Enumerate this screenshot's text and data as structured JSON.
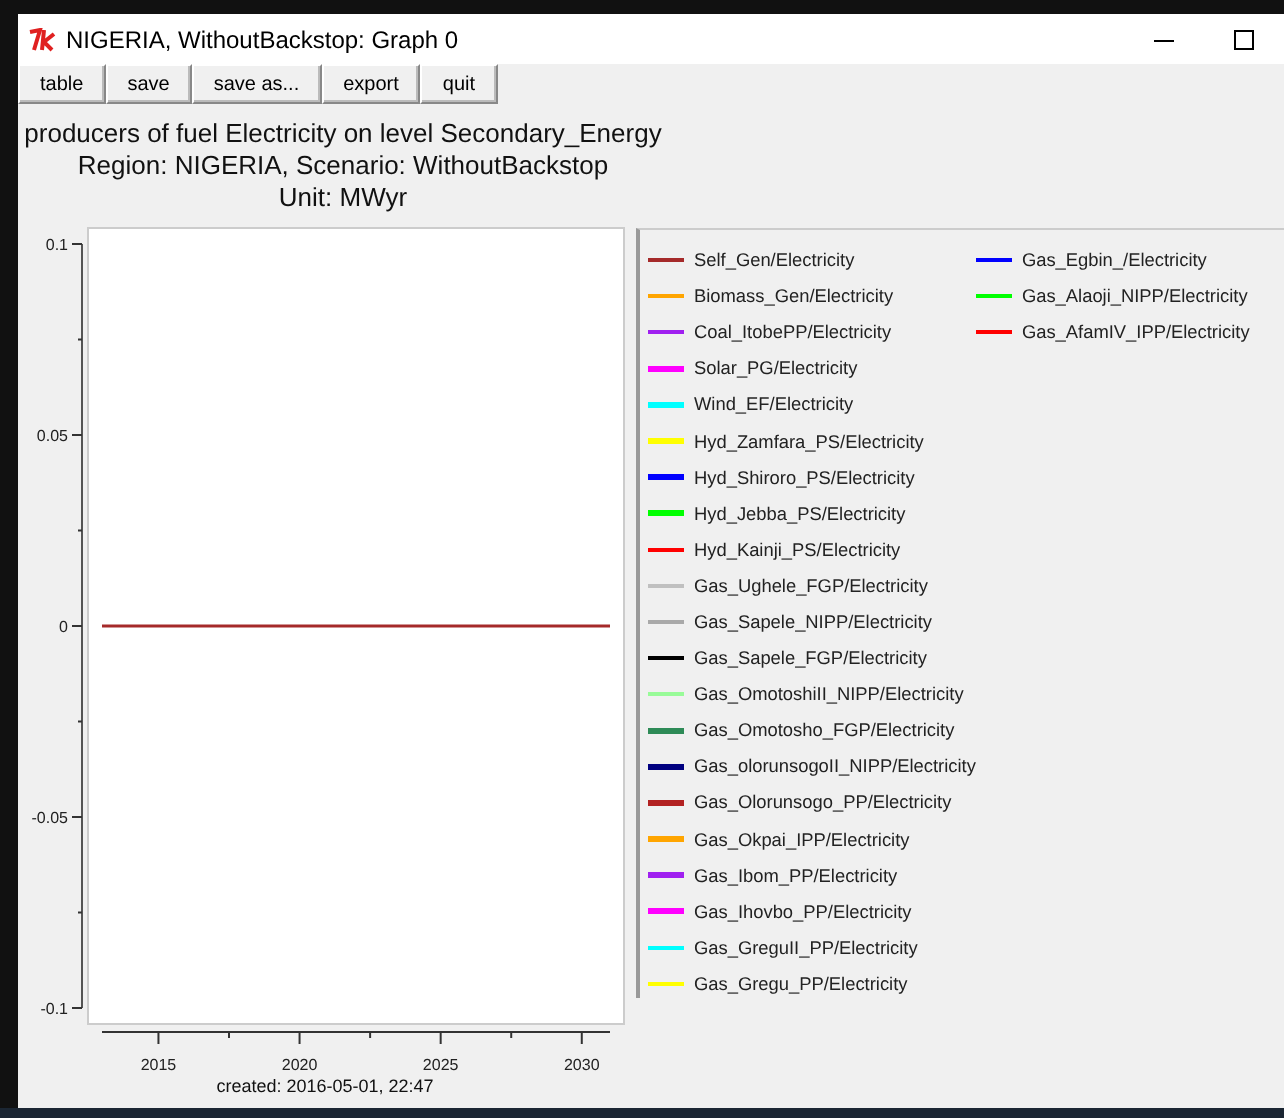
{
  "window": {
    "title": "NIGERIA, WithoutBackstop: Graph 0"
  },
  "toolbar": [
    "table",
    "save",
    "save as...",
    "export",
    "quit"
  ],
  "heading": [
    "producers of fuel Electricity on level Secondary_Energy",
    "Region: NIGERIA, Scenario: WithoutBackstop",
    "Unit: MWyr"
  ],
  "chart_data": {
    "type": "line",
    "legend": "right",
    "x": [
      2013,
      2031
    ],
    "xlim": [
      2013,
      2031
    ],
    "ylim": [
      -0.1,
      0.1
    ],
    "xticks": [
      2015,
      2020,
      2025,
      2030
    ],
    "yticks": [
      0.1,
      0.05,
      {
        "value": 0,
        "label": "0"
      },
      -0.05,
      -0.1
    ],
    "series": [
      {
        "name": "Self_Gen/Electricity",
        "color": "#a52a2a",
        "values": [
          0,
          0
        ]
      },
      {
        "name": "Biomass_Gen/Electricity",
        "color": "#ffa500",
        "values": [
          null,
          null
        ]
      },
      {
        "name": "Coal_ItobePP/Electricity",
        "color": "#a020f0",
        "values": [
          null,
          null
        ]
      },
      {
        "name": "Solar_PG/Electricity",
        "color": "#ff00ff",
        "values": [
          null,
          null
        ]
      },
      {
        "name": "Wind_EF/Electricity",
        "color": "#00ffff",
        "values": [
          null,
          null
        ]
      },
      {
        "name": "Hyd_Zamfara_PS/Electricity",
        "color": "#ffff00",
        "values": [
          null,
          null
        ]
      },
      {
        "name": "Hyd_Shiroro_PS/Electricity",
        "color": "#0000ff",
        "values": [
          null,
          null
        ]
      },
      {
        "name": "Hyd_Jebba_PS/Electricity",
        "color": "#00ff00",
        "values": [
          null,
          null
        ]
      },
      {
        "name": "Hyd_Kainji_PS/Electricity",
        "color": "#ff0000",
        "values": [
          null,
          null
        ]
      },
      {
        "name": "Gas_Ughele_FGP/Electricity",
        "color": "#c0c0c0",
        "values": [
          null,
          null
        ]
      },
      {
        "name": "Gas_Sapele_NIPP/Electricity",
        "color": "#a9a9a9",
        "values": [
          null,
          null
        ]
      },
      {
        "name": "Gas_Sapele_FGP/Electricity",
        "color": "#000000",
        "values": [
          null,
          null
        ]
      },
      {
        "name": "Gas_OmotoshiII_NIPP/Electricity",
        "color": "#98fb98",
        "values": [
          null,
          null
        ]
      },
      {
        "name": "Gas_Omotosho_FGP/Electricity",
        "color": "#2e8b57",
        "values": [
          null,
          null
        ]
      },
      {
        "name": "Gas_olorunsogoII_NIPP/Electricity",
        "color": "#000080",
        "values": [
          null,
          null
        ]
      },
      {
        "name": "Gas_Olorunsogo_PP/Electricity",
        "color": "#b22222",
        "values": [
          null,
          null
        ]
      },
      {
        "name": "Gas_Okpai_IPP/Electricity",
        "color": "#ffa500",
        "values": [
          null,
          null
        ]
      },
      {
        "name": "Gas_Ibom_PP/Electricity",
        "color": "#a020f0",
        "values": [
          null,
          null
        ]
      },
      {
        "name": "Gas_Ihovbo_PP/Electricity",
        "color": "#ff00ff",
        "values": [
          null,
          null
        ]
      },
      {
        "name": "Gas_GreguII_PP/Electricity",
        "color": "#00ffff",
        "values": [
          null,
          null
        ]
      },
      {
        "name": "Gas_Gregu_PP/Electricity",
        "color": "#ffff00",
        "values": [
          null,
          null
        ]
      },
      {
        "name": "Gas_Egbin_/Electricity",
        "color": "#0000ff",
        "values": [
          null,
          null
        ]
      },
      {
        "name": "Gas_Alaoji_NIPP/Electricity",
        "color": "#00ff00",
        "values": [
          null,
          null
        ]
      },
      {
        "name": "Gas_AfamIV_IPP/Electricity",
        "color": "#ff0000",
        "values": [
          null,
          null
        ]
      }
    ]
  },
  "footer": "created: 2016-05-01, 22:47"
}
